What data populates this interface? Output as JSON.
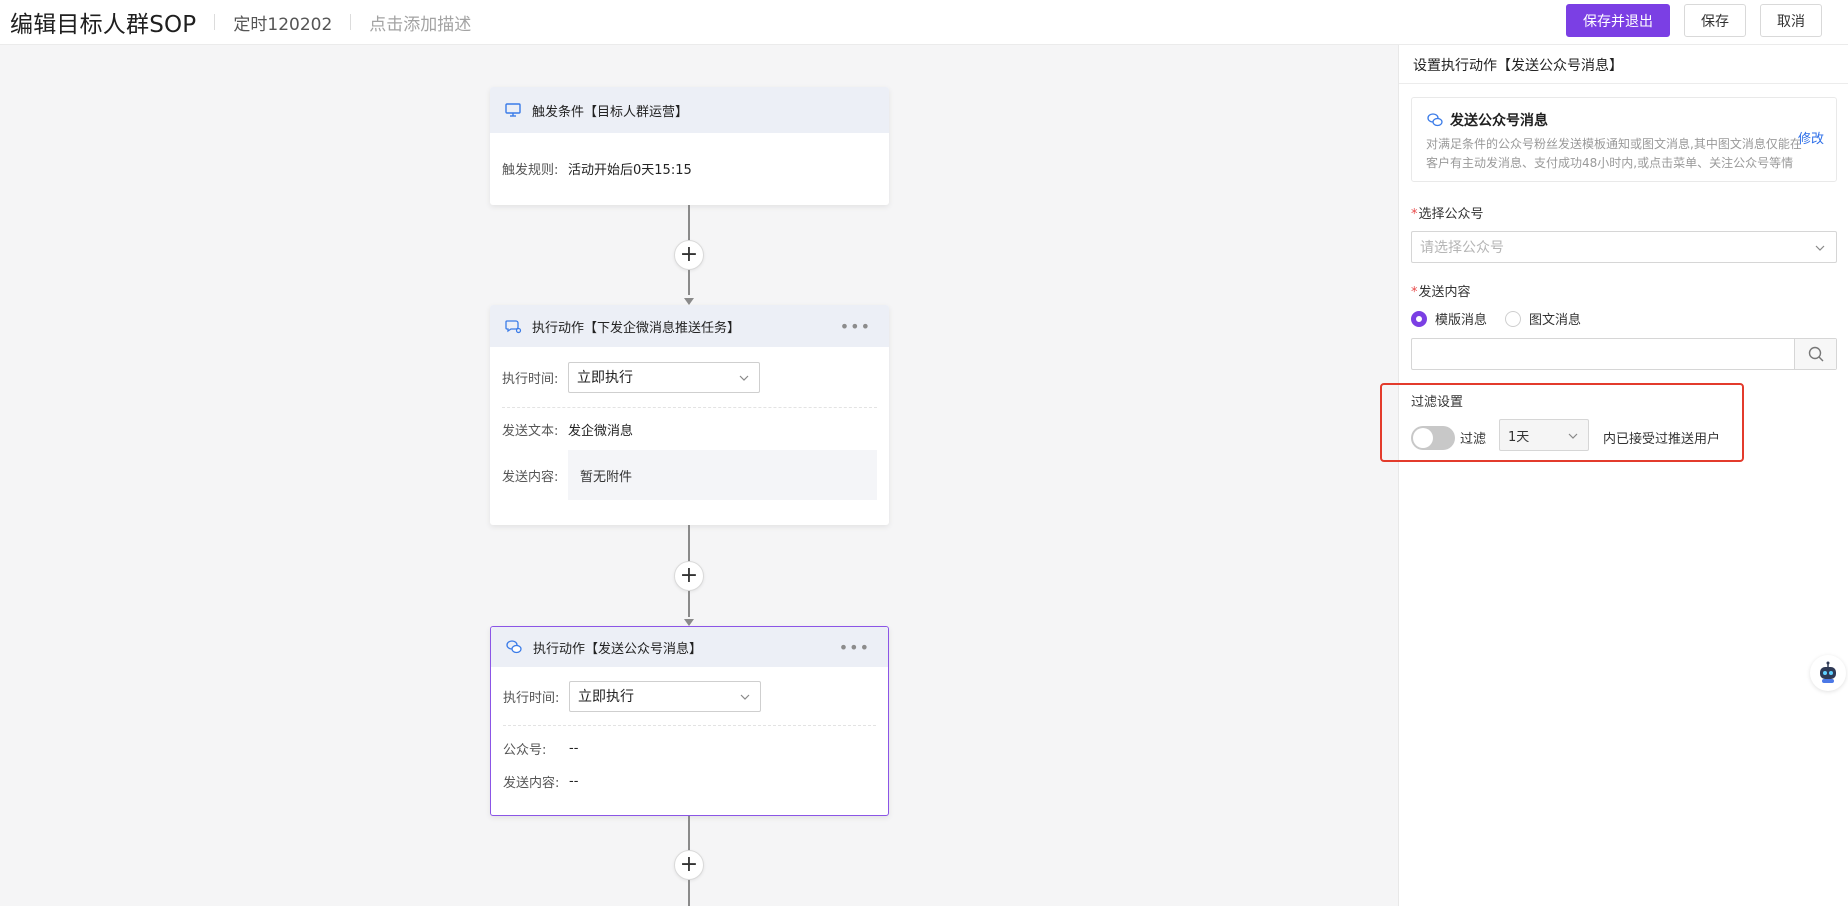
{
  "header": {
    "title": "编辑目标人群SOP",
    "schedule": "定时120202",
    "description_placeholder": "点击添加描述",
    "save_exit_label": "保存并退出",
    "save_label": "保存",
    "cancel_label": "取消"
  },
  "flow": {
    "trigger": {
      "title": "触发条件【目标人群运营】",
      "rule_label": "触发规则:",
      "rule_value": "活动开始后0天15:15"
    },
    "action1": {
      "title": "执行动作【下发企微消息推送任务】",
      "time_label": "执行时间:",
      "time_value": "立即执行",
      "text_label": "发送文本:",
      "text_value": "发企微消息",
      "content_label": "发送内容:",
      "content_value": "暂无附件"
    },
    "action2": {
      "title": "执行动作【发送公众号消息】",
      "time_label": "执行时间:",
      "time_value": "立即执行",
      "account_label": "公众号:",
      "account_value": "--",
      "content_label": "发送内容:",
      "content_value": "--"
    }
  },
  "panel": {
    "title": "设置执行动作【发送公众号消息】",
    "card_title": "发送公众号消息",
    "card_desc": "对满足条件的公众号粉丝发送模板通知或图文消息,其中图文消息仅能在客户有主动发消息、支付成功48小时内,或点击菜单、关注公众号等情况下发送",
    "card_edit": "修改",
    "account_label": "选择公众号",
    "account_placeholder": "请选择公众号",
    "content_label": "发送内容",
    "radio_template": "模版消息",
    "radio_article": "图文消息",
    "filter_title": "过滤设置",
    "filter_toggle_label": "过滤",
    "filter_days": "1天",
    "filter_suffix": "内已接受过推送用户"
  },
  "colors": {
    "primary": "#7b3fe4",
    "highlight": "#e33b2c",
    "link": "#2e6fe8"
  }
}
